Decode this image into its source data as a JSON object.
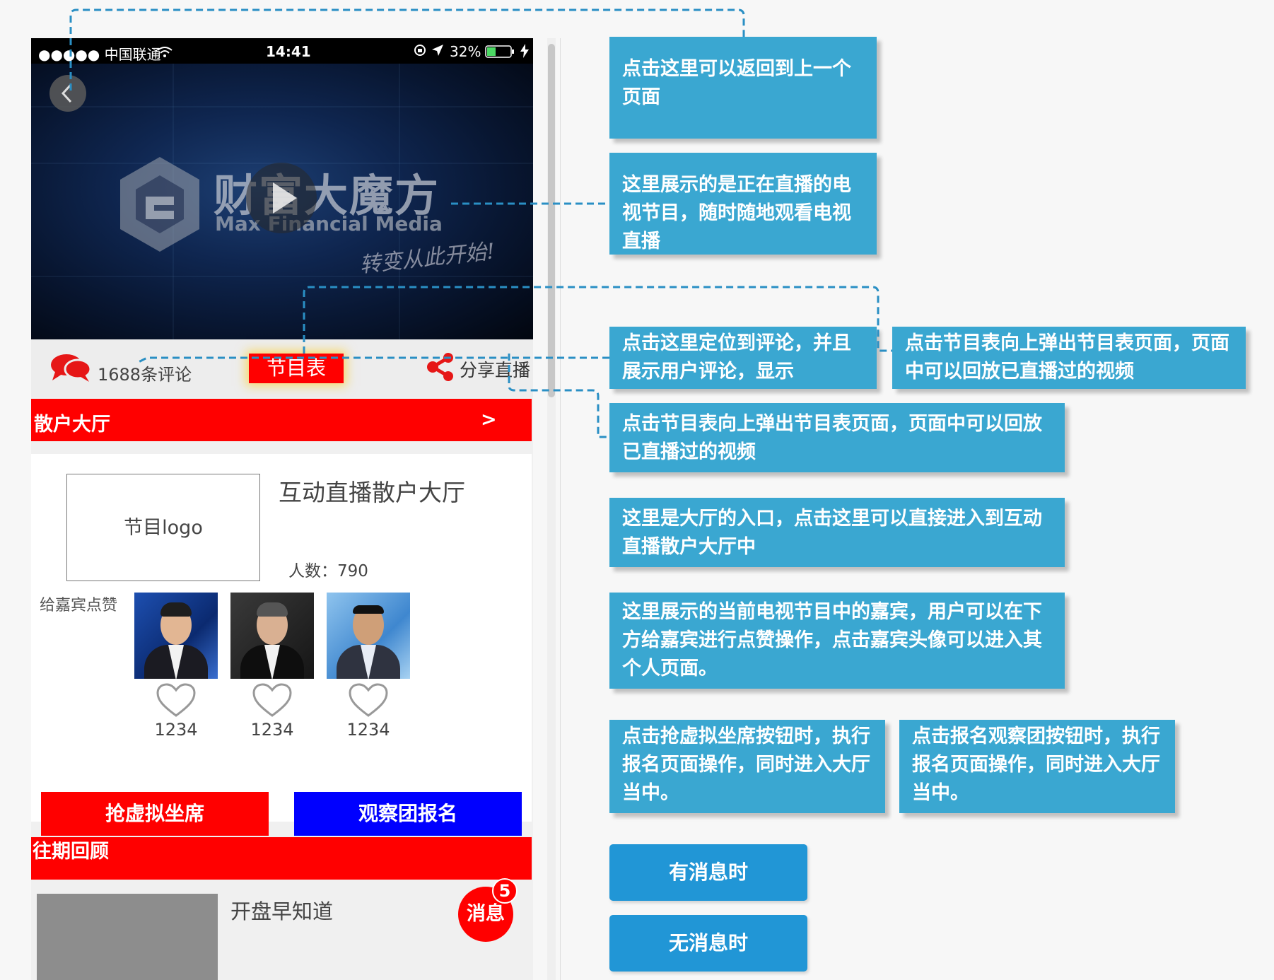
{
  "status_bar": {
    "carrier": "●●●●● 中国联通",
    "time": "14:41",
    "battery": "32%"
  },
  "video": {
    "brand_cn": "财富大魔方",
    "brand_en": "Max Financial Media",
    "slogan": "转变从此开始!"
  },
  "action_bar": {
    "comment_count": "1688条评论",
    "schedule": "节目表",
    "share": "分享直播"
  },
  "hall": {
    "header": "散户大厅",
    "header_arrow": ">",
    "logo_placeholder": "节目logo",
    "title": "互动直播散户大厅",
    "people": "人数：790",
    "guest_prompt": "给嘉宾点赞",
    "guests": [
      {
        "likes": "1234"
      },
      {
        "likes": "1234"
      },
      {
        "likes": "1234"
      }
    ],
    "grab_seat": "抢虚拟坐席",
    "observer_signup": "观察团报名"
  },
  "history": {
    "header": "往期回顾",
    "item_title": "开盘早知道",
    "message_label": "消息",
    "message_count": "5"
  },
  "notes": {
    "back": "点击这里可以返回到上一个页面",
    "live": "这里展示的是正在直播的电视节目，随时随地观看电视直播",
    "comment": "点击这里定位到评论，并且展示用户评论，显示",
    "schedule_a": "点击节目表向上弹出节目表页面，页面中可以回放已直播过的视频",
    "schedule_b": "点击节目表向上弹出节目表页面，页面中可以回放已直播过的视频",
    "hall_entry": "这里是大厅的入口，点击这里可以直接进入到互动直播散户大厅中",
    "guests": "这里展示的当前电视节目中的嘉宾，用户可以在下方给嘉宾进行点赞操作，点击嘉宾头像可以进入其个人页面。",
    "grab_seat": "点击抢虚拟坐席按钮时，执行报名页面操作，同时进入大厅当中。",
    "observer": "点击报名观察团按钮时，执行报名页面操作，同时进入大厅当中。"
  },
  "buttons": {
    "has_message": "有消息时",
    "no_message": "无消息时"
  },
  "colors": {
    "note_bg": "#3aa7d1",
    "button_bg": "#2196d6",
    "accent_red": "#ff0000",
    "accent_blue": "#0000ff",
    "connector": "#2a8fc4"
  }
}
